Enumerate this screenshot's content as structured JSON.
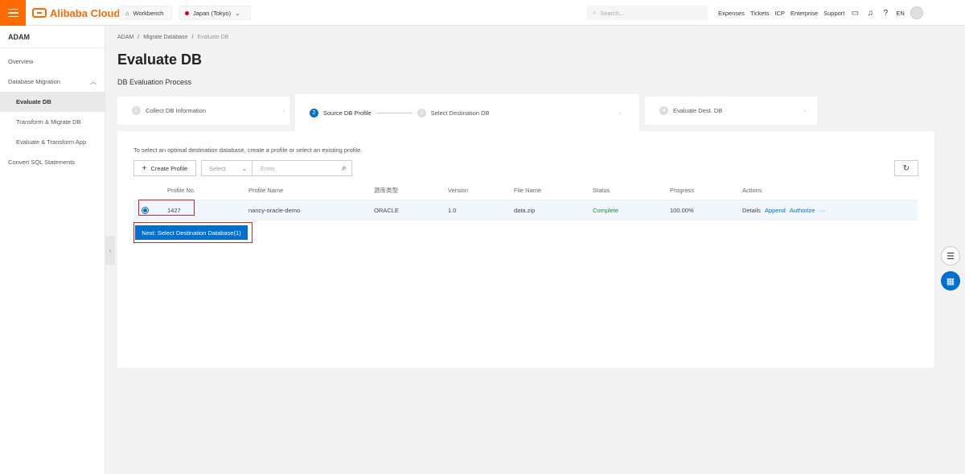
{
  "brand": {
    "name": "Alibaba Cloud",
    "color": "#ff6a00"
  },
  "topbar": {
    "workbench": "Workbench",
    "region": "Japan (Tokyo)",
    "search_placeholder": "Search...",
    "links": [
      "Expenses",
      "Tickets",
      "ICP",
      "Enterprise",
      "Support"
    ],
    "lang": "EN"
  },
  "sidebar": {
    "title": "ADAM",
    "items": [
      {
        "label": "Overview"
      },
      {
        "label": "Database Migration"
      },
      {
        "label": "Evaluate DB"
      },
      {
        "label": "Transform & Migrate DB"
      },
      {
        "label": "Evaluate & Transform App"
      },
      {
        "label": "Convert SQL Statements"
      }
    ]
  },
  "breadcrumb": [
    "ADAM",
    "Migrate Database",
    "Evaluate DB"
  ],
  "page": {
    "title": "Evaluate DB",
    "section": "DB Evaluation Process"
  },
  "steps": [
    {
      "num": "1",
      "label": "Collect DB Information"
    },
    {
      "num": "2",
      "label": "Source DB Profile"
    },
    {
      "num": "3",
      "label": "Select Destination DB"
    },
    {
      "num": "4",
      "label": "Evaluate Dest. DB"
    }
  ],
  "panel": {
    "hint": "To select an optimal destination database, create a profile or select an existing profile.",
    "create_label": "Create Profile",
    "select_placeholder": "Select",
    "enter_placeholder": "Enter",
    "next_label": "Next: Select Destination Database(1)"
  },
  "table": {
    "headers": [
      "Profile No.",
      "Profile Name",
      "源库类型",
      "Version",
      "File Name",
      "Status",
      "Progress",
      "Actions"
    ],
    "rows": [
      {
        "profile_no": "1427",
        "profile_name": "nancy-oracle-demo",
        "source_type": "ORACLE",
        "version": "1.0",
        "file_name": "data.zip",
        "status": "Complete",
        "progress": "100.00%",
        "actions": [
          "Details",
          "Append",
          "Authorize",
          "···"
        ]
      }
    ]
  },
  "colors": {
    "accent": "#0070cc",
    "status_ok": "#1e8e3e",
    "highlight": "#e0202a"
  }
}
